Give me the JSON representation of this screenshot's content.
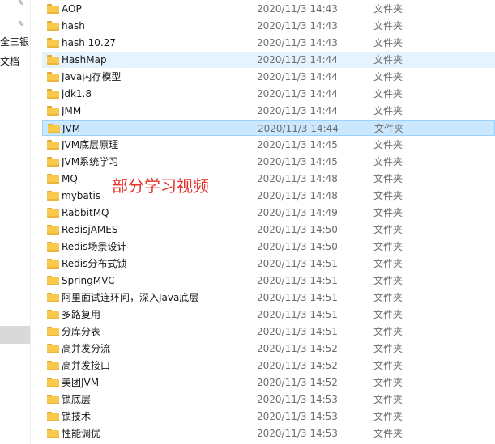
{
  "nav_pane": {
    "labels": [
      "全三银D",
      "文档"
    ]
  },
  "file_list": {
    "rows": [
      {
        "name": "AOP",
        "date": "2020/11/3 14:43",
        "type": "文件夹"
      },
      {
        "name": "hash",
        "date": "2020/11/3 14:43",
        "type": "文件夹"
      },
      {
        "name": "hash 10.27",
        "date": "2020/11/3 14:43",
        "type": "文件夹"
      },
      {
        "name": "HashMap",
        "date": "2020/11/3 14:44",
        "type": "文件夹"
      },
      {
        "name": "Java内存模型",
        "date": "2020/11/3 14:44",
        "type": "文件夹"
      },
      {
        "name": "jdk1.8",
        "date": "2020/11/3 14:44",
        "type": "文件夹"
      },
      {
        "name": "JMM",
        "date": "2020/11/3 14:44",
        "type": "文件夹"
      },
      {
        "name": "JVM",
        "date": "2020/11/3 14:44",
        "type": "文件夹"
      },
      {
        "name": "JVM底层原理",
        "date": "2020/11/3 14:45",
        "type": "文件夹"
      },
      {
        "name": "JVM系统学习",
        "date": "2020/11/3 14:45",
        "type": "文件夹"
      },
      {
        "name": "MQ",
        "date": "2020/11/3 14:48",
        "type": "文件夹"
      },
      {
        "name": "mybatis",
        "date": "2020/11/3 14:48",
        "type": "文件夹"
      },
      {
        "name": "RabbitMQ",
        "date": "2020/11/3 14:49",
        "type": "文件夹"
      },
      {
        "name": "RedisjAMES",
        "date": "2020/11/3 14:50",
        "type": "文件夹"
      },
      {
        "name": "Redis场景设计",
        "date": "2020/11/3 14:50",
        "type": "文件夹"
      },
      {
        "name": "Redis分布式锁",
        "date": "2020/11/3 14:51",
        "type": "文件夹"
      },
      {
        "name": "SpringMVC",
        "date": "2020/11/3 14:51",
        "type": "文件夹"
      },
      {
        "name": "阿里面试连环问，深入Java底层",
        "date": "2020/11/3 14:51",
        "type": "文件夹"
      },
      {
        "name": "多路复用",
        "date": "2020/11/3 14:51",
        "type": "文件夹"
      },
      {
        "name": "分库分表",
        "date": "2020/11/3 14:51",
        "type": "文件夹"
      },
      {
        "name": "高并发分流",
        "date": "2020/11/3 14:52",
        "type": "文件夹"
      },
      {
        "name": "高并发接口",
        "date": "2020/11/3 14:52",
        "type": "文件夹"
      },
      {
        "name": "美团JVM",
        "date": "2020/11/3 14:52",
        "type": "文件夹"
      },
      {
        "name": "锁底层",
        "date": "2020/11/3 14:53",
        "type": "文件夹"
      },
      {
        "name": "锁技术",
        "date": "2020/11/3 14:53",
        "type": "文件夹"
      },
      {
        "name": "性能调优",
        "date": "2020/11/3 14:53",
        "type": "文件夹"
      }
    ],
    "hover_row": "HashMap",
    "selected_row": "JVM"
  },
  "annotation": {
    "text": "部分学习视频",
    "color": "#e8322a"
  },
  "icons": {
    "pin": "pin-icon",
    "folder": "folder-icon"
  }
}
